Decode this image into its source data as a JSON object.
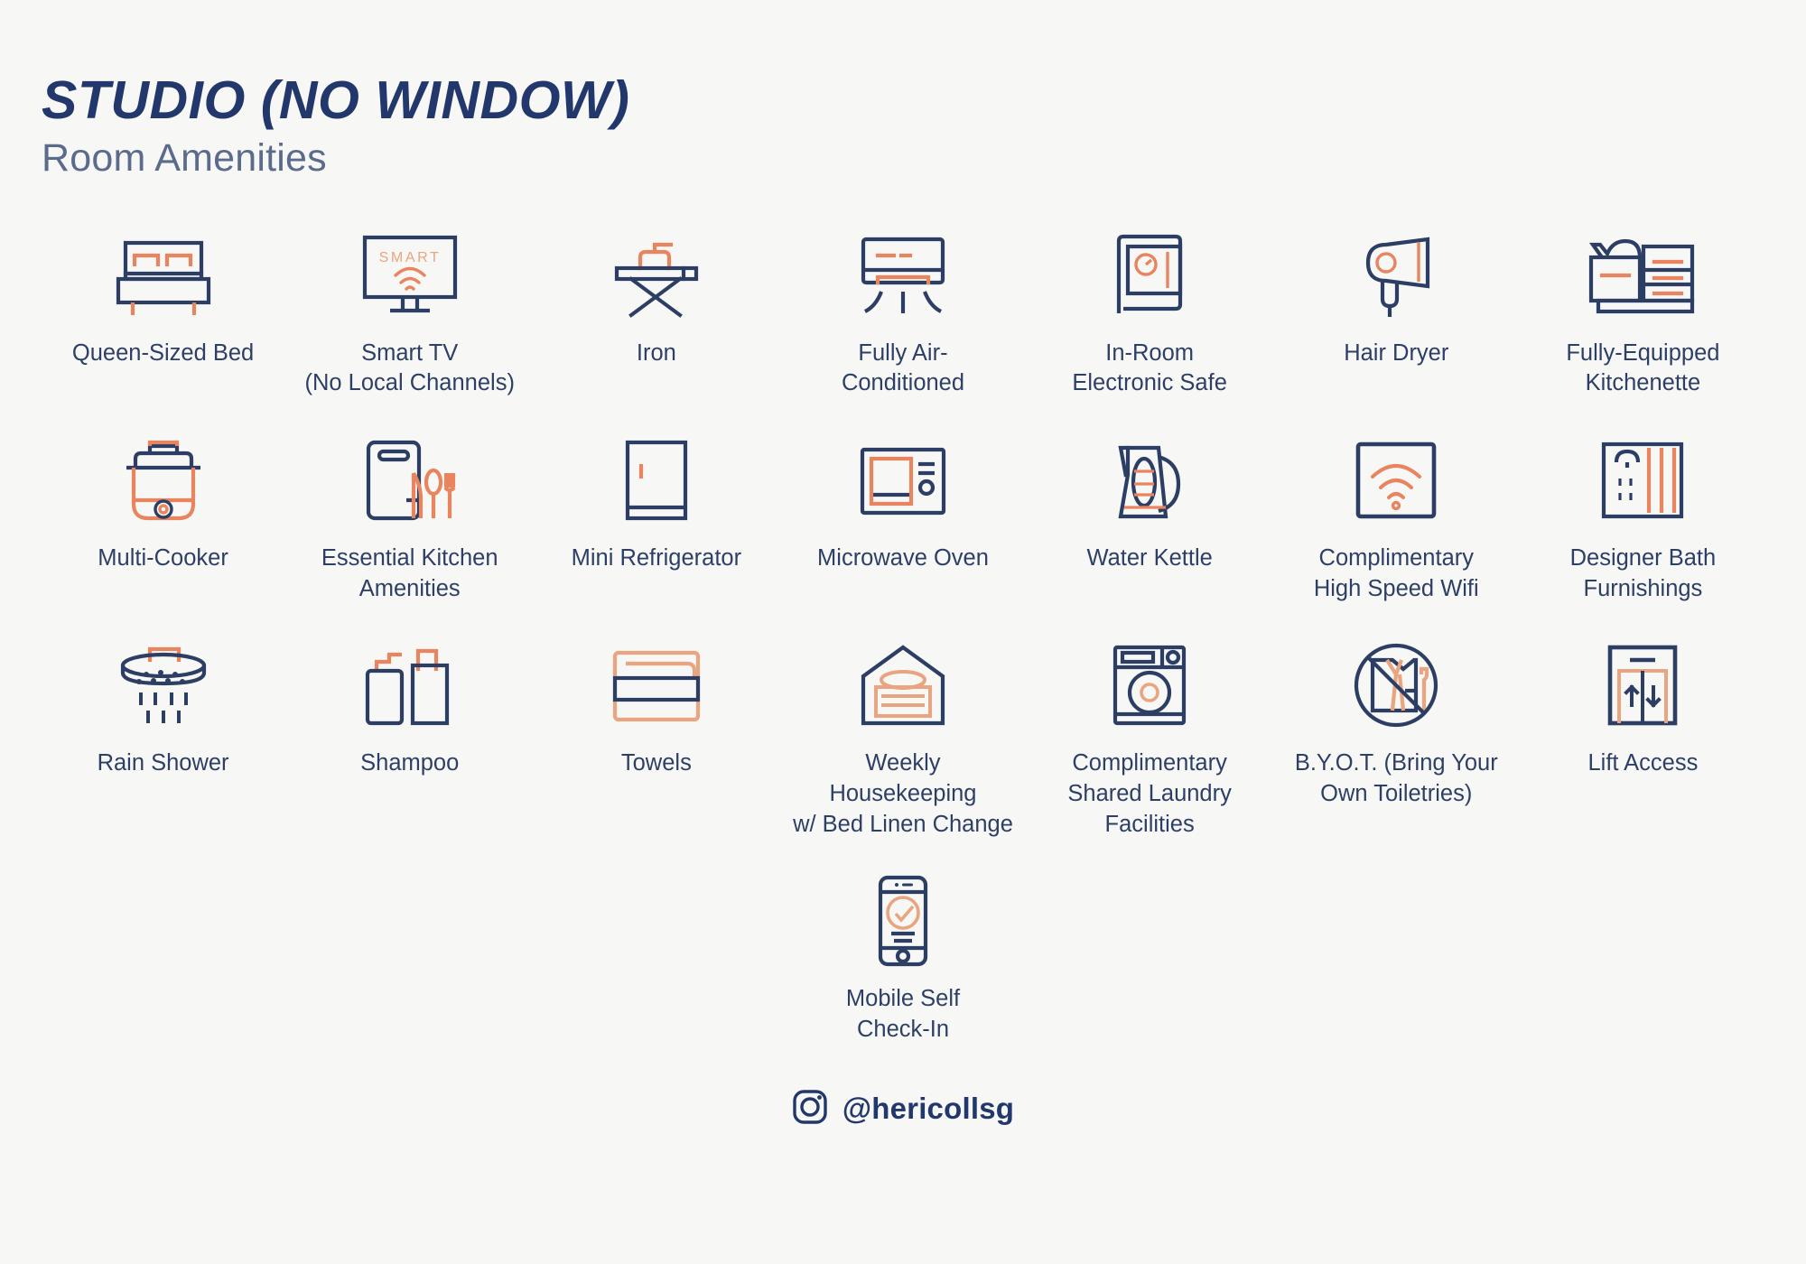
{
  "header": {
    "title": "STUDIO (NO WINDOW)",
    "subtitle": "Room Amenities"
  },
  "colors": {
    "navy": "#2c3e63",
    "orange": "#e8855f",
    "orange_light": "#edaa89",
    "background": "#f7f7f6",
    "text": "#2e3f66",
    "subtitle_text": "#5b6b8c"
  },
  "amenities": [
    {
      "icon": "bed-icon",
      "label": "Queen-Sized Bed"
    },
    {
      "icon": "smart-tv-icon",
      "label": "Smart TV\n(No Local Channels)",
      "screen_text": "SMART"
    },
    {
      "icon": "iron-icon",
      "label": "Iron"
    },
    {
      "icon": "air-conditioner-icon",
      "label": "Fully Air-\nConditioned"
    },
    {
      "icon": "safe-icon",
      "label": "In-Room\nElectronic Safe"
    },
    {
      "icon": "hair-dryer-icon",
      "label": "Hair Dryer"
    },
    {
      "icon": "kitchenette-icon",
      "label": "Fully-Equipped\nKitchenette"
    },
    {
      "icon": "multi-cooker-icon",
      "label": "Multi-Cooker"
    },
    {
      "icon": "cutlery-board-icon",
      "label": "Essential Kitchen\nAmenities"
    },
    {
      "icon": "refrigerator-icon",
      "label": "Mini Refrigerator"
    },
    {
      "icon": "microwave-icon",
      "label": "Microwave Oven"
    },
    {
      "icon": "kettle-icon",
      "label": "Water Kettle"
    },
    {
      "icon": "wifi-icon",
      "label": "Complimentary\nHigh Speed Wifi"
    },
    {
      "icon": "bath-furnishings-icon",
      "label": "Designer Bath\nFurnishings"
    },
    {
      "icon": "rain-shower-icon",
      "label": "Rain Shower"
    },
    {
      "icon": "shampoo-icon",
      "label": "Shampoo"
    },
    {
      "icon": "towels-icon",
      "label": "Towels"
    },
    {
      "icon": "housekeeping-icon",
      "label": "Weekly Housekeeping\nw/ Bed Linen Change"
    },
    {
      "icon": "laundry-icon",
      "label": "Complimentary\nShared Laundry\nFacilities"
    },
    {
      "icon": "no-toiletries-icon",
      "label": "B.Y.O.T. (Bring Your\nOwn Toiletries)"
    },
    {
      "icon": "lift-icon",
      "label": "Lift Access"
    },
    {
      "icon": "mobile-checkin-icon",
      "label": "Mobile Self\nCheck-In"
    }
  ],
  "footer": {
    "icon": "instagram-icon",
    "handle": "@hericollsg"
  }
}
